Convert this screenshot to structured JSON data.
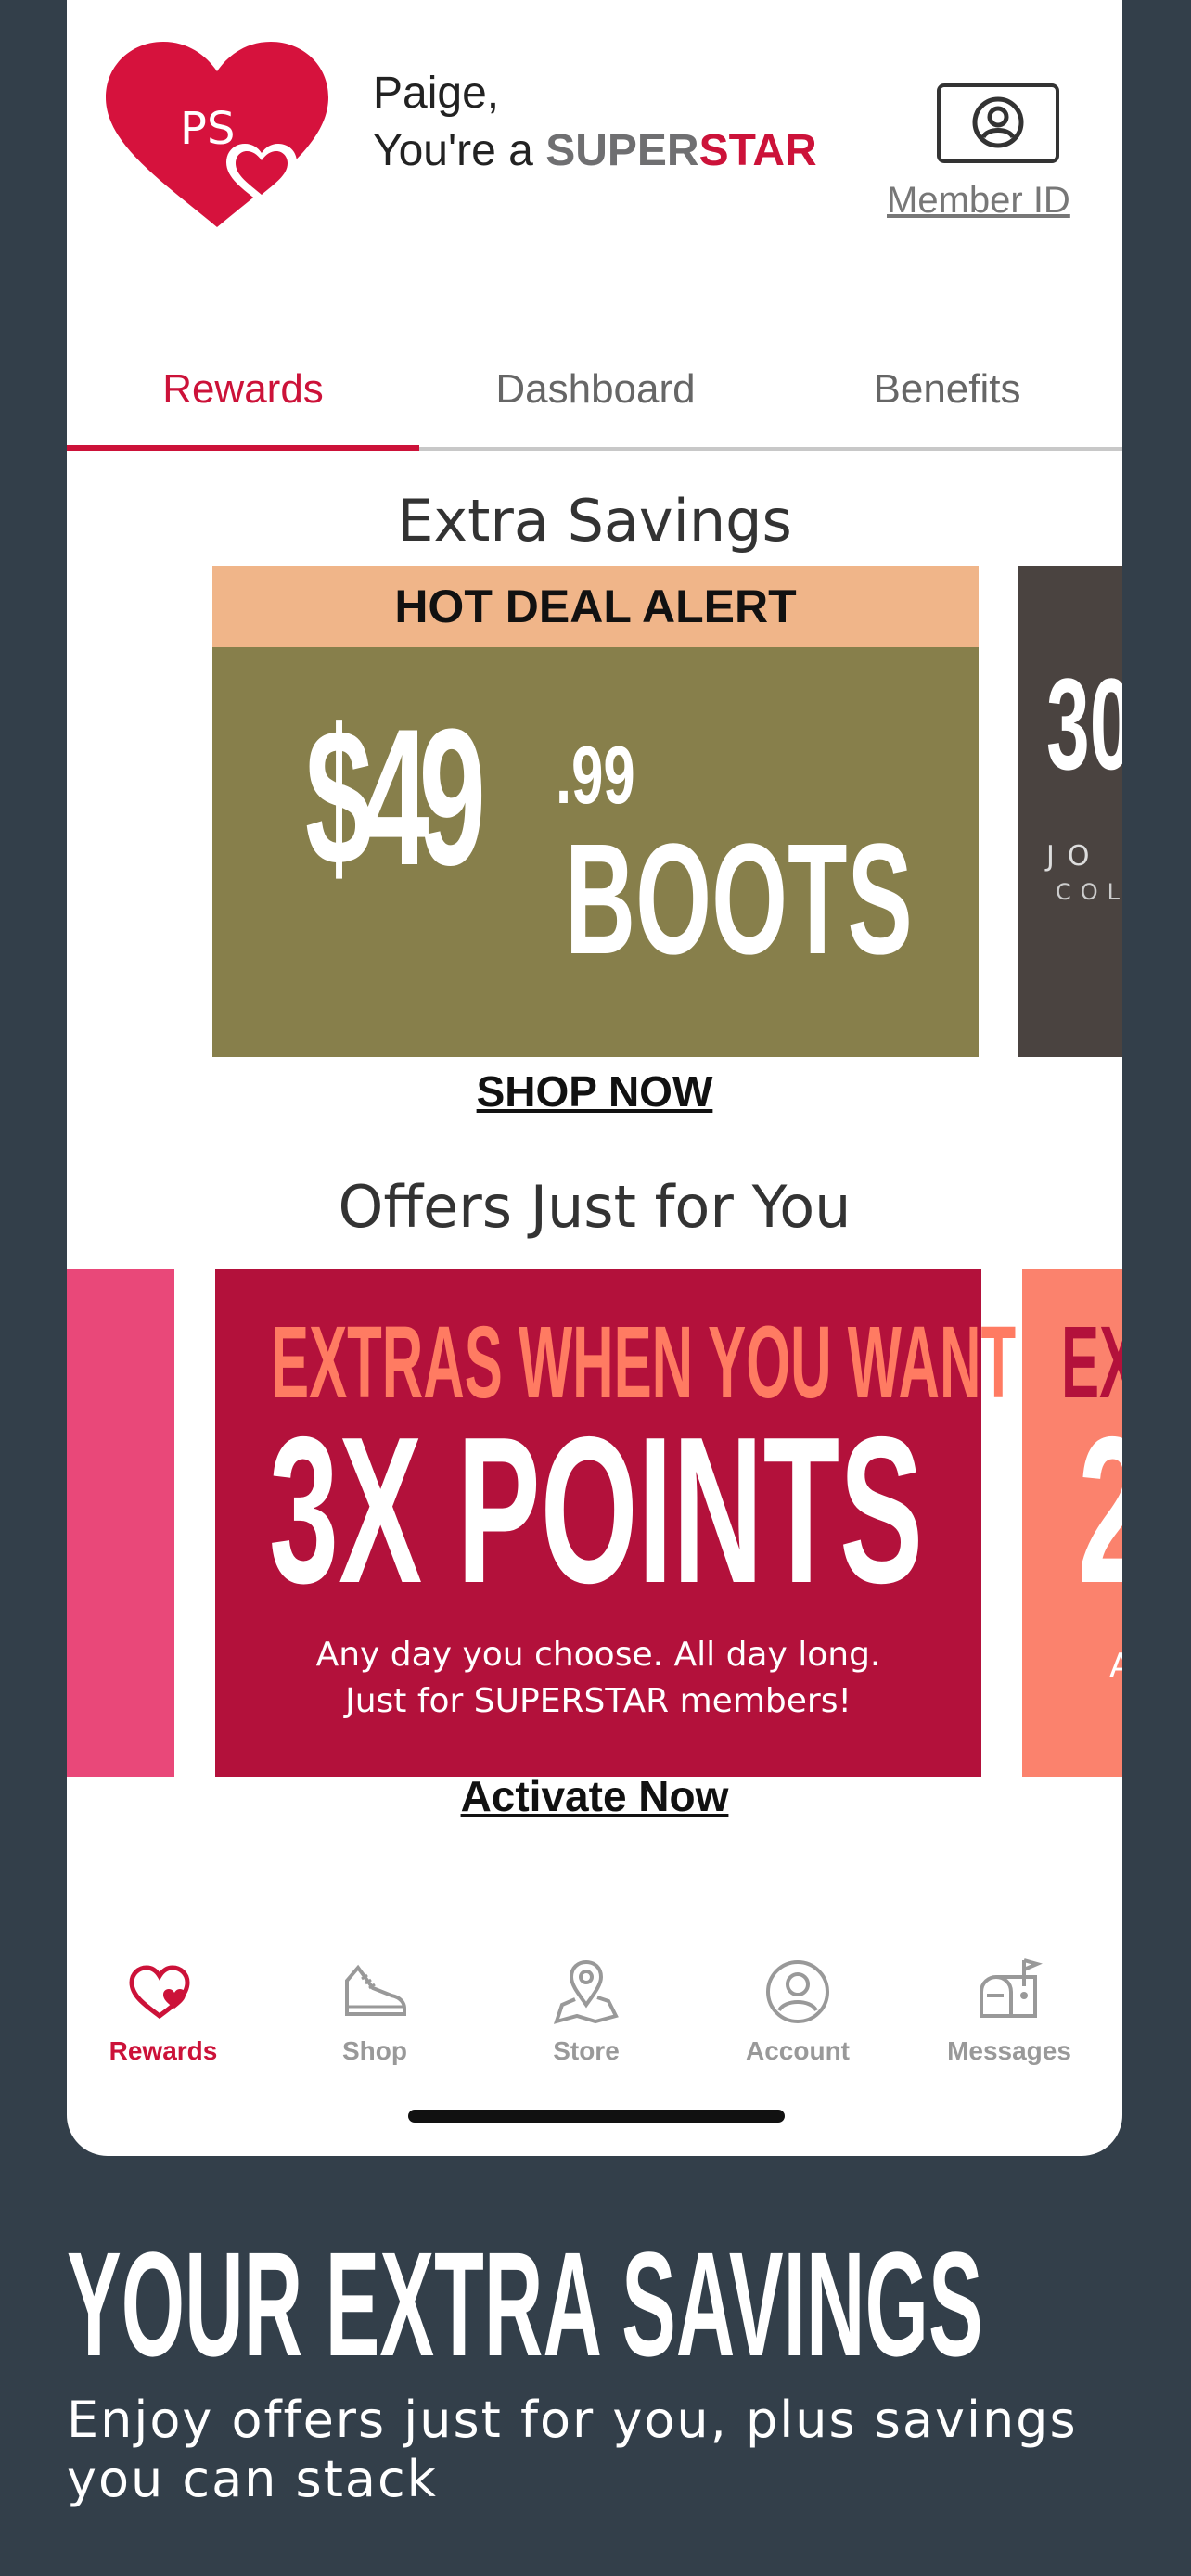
{
  "header": {
    "initials": "PS",
    "greeting_name": "Paige,",
    "greeting_prefix": "You're a ",
    "tier_part1": "SUPER",
    "tier_part2": "STAR",
    "member_id_label": "Member ID"
  },
  "tabs": [
    {
      "label": "Rewards",
      "active": true
    },
    {
      "label": "Dashboard",
      "active": false
    },
    {
      "label": "Benefits",
      "active": false
    }
  ],
  "extra_savings": {
    "title": "Extra Savings",
    "card": {
      "banner": "HOT DEAL ALERT",
      "price_main": "$49",
      "price_cents": ".99",
      "product": "BOOTS"
    },
    "next_card_peek": {
      "big": "30",
      "line1": "JO",
      "line2": "COL"
    },
    "link": "SHOP NOW"
  },
  "offers": {
    "title": "Offers Just for You",
    "card": {
      "headline": "EXTRAS WHEN YOU WANT",
      "big": "3X POINTS",
      "sub1": "Any day you choose. All day long.",
      "sub2": "Just for SUPERSTAR members!"
    },
    "next_card_peek": {
      "headline": "EX",
      "big": "2",
      "sub": "A"
    },
    "link": "Activate Now"
  },
  "bottom_nav": [
    {
      "label": "Rewards",
      "icon": "heart-icon",
      "active": true
    },
    {
      "label": "Shop",
      "icon": "shoe-icon",
      "active": false
    },
    {
      "label": "Store",
      "icon": "map-pin-icon",
      "active": false
    },
    {
      "label": "Account",
      "icon": "account-icon",
      "active": false
    },
    {
      "label": "Messages",
      "icon": "mailbox-icon",
      "active": false
    }
  ],
  "promo": {
    "title": "YOUR EXTRA SAVINGS",
    "subtitle_line1": "Enjoy offers just for you, plus savings",
    "subtitle_line2": "you can stack"
  },
  "colors": {
    "accent": "#cc1239",
    "background": "#333f4a",
    "deal_card": "#877f4b",
    "deal_banner": "#f0b589",
    "offer_card": "#b3113b"
  }
}
